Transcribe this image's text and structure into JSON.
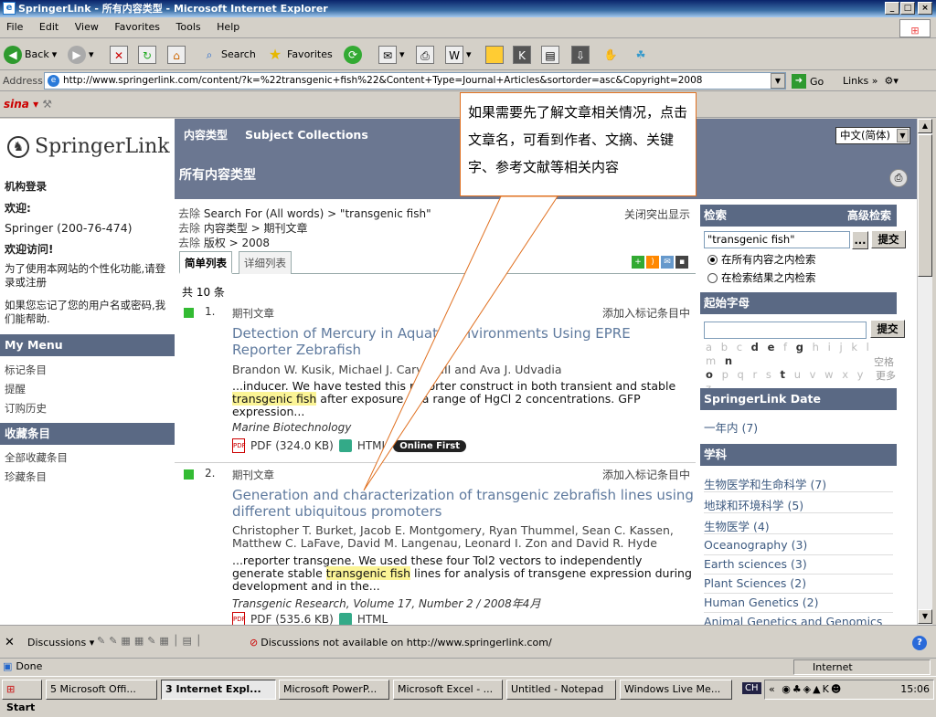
{
  "window": {
    "title": "SpringerLink - 所有内容类型 - Microsoft Internet Explorer"
  },
  "menu": [
    "File",
    "Edit",
    "View",
    "Favorites",
    "Tools",
    "Help"
  ],
  "toolbar": {
    "back": "Back",
    "search": "Search",
    "favorites": "Favorites"
  },
  "address": {
    "label": "Address",
    "url": "http://www.springerlink.com/content/?k=%22transgenic+fish%22&Content+Type=Journal+Articles&sortorder=asc&Copyright=2008",
    "go": "Go",
    "links": "Links"
  },
  "sina": "sina",
  "leftnav": {
    "logo": "SpringerLink",
    "inst_login": "机构登录",
    "welcome": "欢迎:",
    "account": "Springer (200-76-474)",
    "welcome_visit": "欢迎访问!",
    "personalize": "为了使用本网站的个性化功能,请登录或注册",
    "forgot": "如果您忘记了您的用户名或密码,我们能帮助.",
    "mymenu": "My Menu",
    "mymenu_items": [
      "标记条目",
      "提醒",
      "订购历史"
    ],
    "collections": "收藏条目",
    "collection_items": [
      "全部收藏条目",
      "珍藏条目"
    ]
  },
  "header": {
    "tab_content_types": "内容类型",
    "tab_subject": "Subject Collections",
    "page_title": "所有内容类型",
    "language": "中文(简体)"
  },
  "filters": {
    "remove": "去除",
    "items": [
      "Search For (All words) > \"transgenic fish\"",
      "内容类型 > 期刊文章",
      "版权 > 2008"
    ],
    "close_highlight": "关闭突出显示"
  },
  "tabs": {
    "simple": "简单列表",
    "detailed": "详细列表"
  },
  "count": "共 10 条",
  "results": [
    {
      "num": "1.",
      "kind": "期刊文章",
      "add": "添加入标记条目中",
      "title": "Detection of Mercury in Aquatic Environments Using EPRE Reporter Zebrafish",
      "authors": "Brandon W. Kusik, Michael J. Carvan III and Ava J. Udvadia",
      "snippet_pre": "...inducer. We have tested this reporter construct in both transient and stable ",
      "snippet_hl": "transgenic fish",
      "snippet_post": " after exposure to a range of HgCl 2 concentrations. GFP expression...",
      "journal": "Marine Biotechnology",
      "pdf": "PDF (324.0 KB)",
      "html": "HTML",
      "badge": "Online First"
    },
    {
      "num": "2.",
      "kind": "期刊文章",
      "add": "添加入标记条目中",
      "title": "Generation and characterization of transgenic zebrafish lines using different ubiquitous promoters",
      "authors": "Christopher T. Burket, Jacob E. Montgomery, Ryan Thummel, Sean C. Kassen, Matthew C. LaFave, David M. Langenau, Leonard I. Zon and David R. Hyde",
      "snippet_pre": "...reporter transgene. We used these four Tol2 vectors to independently generate stable ",
      "snippet_hl": "transgenic fish",
      "snippet_post": " lines for analysis of transgene expression during development and in the...",
      "journal": "Transgenic Research, Volume 17, Number 2 / 2008年4月",
      "pdf": "PDF (535.6 KB)",
      "html": "HTML"
    }
  ],
  "sidebar": {
    "search_head": "检索",
    "advanced": "高级检索",
    "search_value": "\"transgenic fish\"",
    "ellipsis": "...",
    "submit": "提交",
    "radio_all": "在所有内容之内检索",
    "radio_results": "在检索结果之内检索",
    "start_letter": "起始字母",
    "submit2": "提交",
    "letters_row1": [
      "a",
      "b",
      "c",
      "d",
      "e",
      "f",
      "g",
      "h",
      "i",
      "j",
      "k",
      "l",
      "m",
      "n"
    ],
    "letters_row2": [
      "o",
      "p",
      "q",
      "r",
      "s",
      "t",
      "u",
      "v",
      "w",
      "x",
      "y",
      "z"
    ],
    "space": "空格",
    "more": "更多",
    "date_head": "SpringerLink Date",
    "date_item": "一年内 (7)",
    "subject_head": "学科",
    "subjects": [
      "生物医学和生命科学 (7)",
      "地球和环境科学 (5)",
      "生物医学 (4)",
      "Oceanography (3)",
      "Earth sciences (3)",
      "Plant Sciences (2)",
      "Human Genetics (2)",
      "Animal Genetics and Genomics"
    ]
  },
  "callout": "如果需要先了解文章相关情况，点击文章名，可看到作者、文摘、关键字、参考文献等相关内容",
  "discussions": {
    "label": "Discussions ▾",
    "message": "Discussions not available on http://www.springerlink.com/"
  },
  "status": {
    "done": "Done",
    "zone": "Internet"
  },
  "taskbar": {
    "start": "Start",
    "tasks": [
      "5 Microsoft Offi...",
      "3 Internet Expl...",
      "Microsoft PowerP...",
      "Microsoft Excel - ...",
      "Untitled - Notepad",
      "Windows Live Me..."
    ],
    "lang": "CH",
    "time": "15:06"
  }
}
